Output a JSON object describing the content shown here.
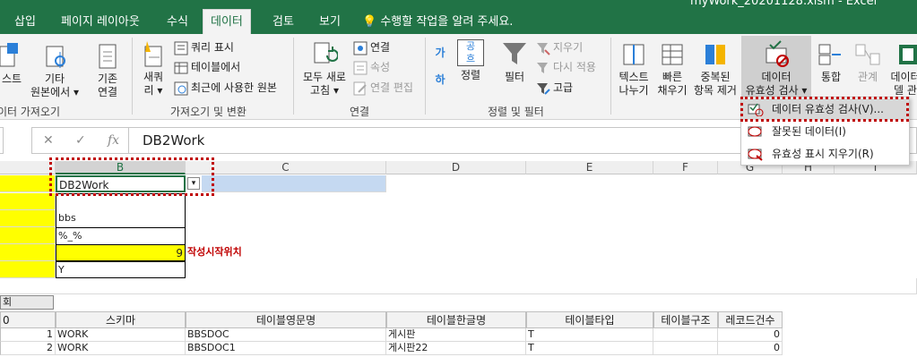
{
  "titlebar": {
    "title": "myWork_20201128.xlsm - Excel"
  },
  "tabs": [
    {
      "label": "삽입"
    },
    {
      "label": "페이지 레이아웃"
    },
    {
      "label": "수식"
    },
    {
      "label": "데이터"
    },
    {
      "label": "검토"
    },
    {
      "label": "보기"
    }
  ],
  "tellme": "수행할 작업을 알려 주세요.",
  "ribbon": {
    "get_external": {
      "text_btn": "스트",
      "other_sources": [
        "기타",
        "원본에서"
      ],
      "existing_conn": [
        "기존",
        "연결"
      ],
      "group_label": "이터 가져오기"
    },
    "get_transform": {
      "new_query": [
        "새쿼",
        "리"
      ],
      "show_queries": "쿼리 표시",
      "from_table": "테이블에서",
      "recent_sources": "최근에 사용한 원본",
      "group_label": "가져오기 및 변환"
    },
    "connections": {
      "refresh_all": [
        "모두 새로",
        "고침"
      ],
      "connections": "연결",
      "properties": "속성",
      "edit_links": "연결 편집",
      "group_label": "연결"
    },
    "sort_filter": {
      "sort": "정렬",
      "filter": "필터",
      "clear": "지우기",
      "reapply": "다시 적용",
      "advanced": "고급",
      "sort_az": "가",
      "sort_za": "하",
      "sort_icon_top": "공",
      "sort_icon_bottom": "흐",
      "group_label": "정렬 및 필터"
    },
    "data_tools": {
      "text_to_columns": [
        "텍스트",
        "나누기"
      ],
      "flash_fill": [
        "빠른",
        "채우기"
      ],
      "remove_duplicates": [
        "중복된",
        "항목 제거"
      ],
      "data_validation": [
        "데이터",
        "유효성 검사"
      ],
      "consolidate": "통합",
      "relationships": "관계",
      "data_model": [
        "데이터",
        "델 관"
      ]
    }
  },
  "dropdown": {
    "items": [
      {
        "label": "데이터 유효성 검사(V)..."
      },
      {
        "label": "잘못된 데이터(I)"
      },
      {
        "label": "유효성 표시 지우기(R)"
      }
    ]
  },
  "formula_bar": {
    "cancel": "✕",
    "enter": "✓",
    "fx": "fx",
    "value": "DB2Work"
  },
  "columns": [
    "B",
    "C",
    "D",
    "E",
    "F",
    "G",
    "H",
    "I"
  ],
  "cells": {
    "b1": "DB2Work",
    "b3": "bbs",
    "b4": "%_%",
    "b5": "9",
    "c5": "작성시작위치",
    "b6": "Y",
    "button_label": "회"
  },
  "table": {
    "headers": [
      "스키마",
      "테이블영문명",
      "테이블한글명",
      "테이블타입",
      "테이블구조",
      "레코드건수"
    ],
    "first_col_header": "0",
    "rows": [
      {
        "no": "1",
        "schema": "WORK",
        "eng": "BBSDOC",
        "kor": "게시판",
        "type": "T",
        "struct": "",
        "count": "0"
      },
      {
        "no": "2",
        "schema": "WORK",
        "eng": "BBSDOC1",
        "kor": "게시판22",
        "type": "T",
        "struct": "",
        "count": "0"
      }
    ]
  },
  "colors": {
    "accent": "#217346",
    "highlight_red": "#c00000",
    "yellow": "#ffff00",
    "blue_fill": "#c5d9f1"
  }
}
